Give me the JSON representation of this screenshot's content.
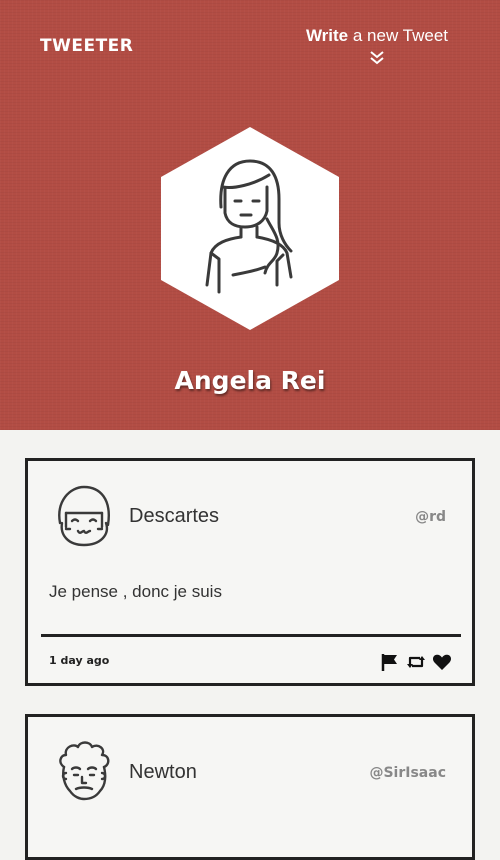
{
  "header": {
    "brand": "TWEETER",
    "write_bold": "Write",
    "write_rest": " a new Tweet",
    "profile_name": "Angela Rei"
  },
  "tweets": [
    {
      "author": "Descartes",
      "handle": "@rd",
      "text": "Je pense , donc je suis",
      "time": "1 day ago"
    },
    {
      "author": "Newton",
      "handle": "@SirIsaac"
    }
  ],
  "colors": {
    "header_bg": "#b24d44",
    "page_bg": "#f3f3f1",
    "card_border": "#222222"
  }
}
